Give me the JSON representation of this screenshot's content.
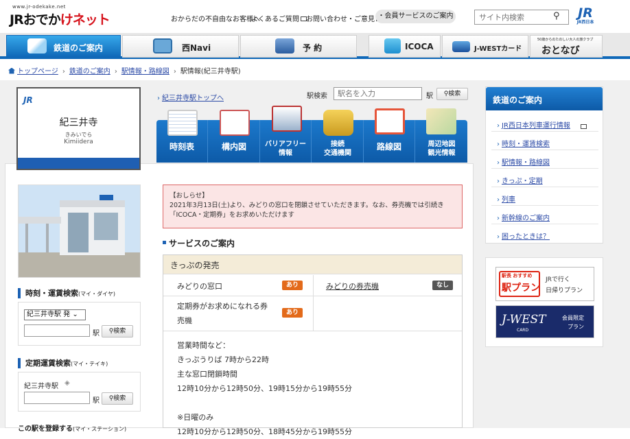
{
  "header": {
    "site_url": "www.jr-odekake.net",
    "logo_text_a": "JRおでか",
    "logo_text_b": "けネット",
    "util_links": [
      "おからだの不自由なお客様へ",
      "よくあるご質問",
      "お問い合わせ・ご意見"
    ],
    "member_button": "・会員サービスのご案内",
    "search_placeholder": "サイト内検索",
    "jr_logo_text": "JR",
    "jr_logo_sub": "JR西日本"
  },
  "global_nav": [
    {
      "label": "鉄道のご案内",
      "icon": "train-icon",
      "active": true
    },
    {
      "label": "西Navi",
      "icon": "camera-icon",
      "active": false
    },
    {
      "label": "予 約",
      "icon": "airplane-icon",
      "active": false
    },
    {
      "label": "ICOCA",
      "icon": "icoca-icon",
      "active": false
    },
    {
      "label": "J-WESTカード",
      "icon": "card-icon",
      "active": false
    },
    {
      "label": "おとなび",
      "icon": "otonavi-logo",
      "sublabel": "50歳からのたのしい大人の旅クラブ",
      "active": false
    }
  ],
  "breadcrumb": [
    "トップページ",
    "鉄道のご案内",
    "駅情報・路線図",
    "駅情報(紀三井寺駅)"
  ],
  "station": {
    "jr": "JR",
    "name": "紀三井寺",
    "kana": "きみいでら",
    "roman": "Kimiidera",
    "top_link": "紀三井寺駅トップへ"
  },
  "station_search": {
    "label": "駅検索",
    "placeholder": "駅名を入力",
    "suffix": "駅",
    "button": "検索"
  },
  "station_menu": [
    {
      "label": "時刻表",
      "icon": "timetable-icon"
    },
    {
      "label": "構内図",
      "icon": "floor-map-icon"
    },
    {
      "label": "バリアフリー\n情報",
      "icon": "barrier-free-icon"
    },
    {
      "label": "接続\n交通機関",
      "icon": "bus-icon"
    },
    {
      "label": "路線図",
      "icon": "route-map-icon"
    },
    {
      "label": "周辺地図\n観光情報",
      "icon": "map-icon"
    }
  ],
  "notice": {
    "title": "【おしらせ】",
    "line1": "2021年3月13日(土)より、みどりの窓口を閉鎖させていただきます。なお、券売機では引続き",
    "line2": "「ICOCA・定期券」をお求めいただけます"
  },
  "services": {
    "title": "サービスのご案内",
    "section": "きっぷの発売",
    "rows": [
      {
        "label": "みどりの窓口",
        "badge": "あり"
      },
      {
        "label": "みどりの券売機",
        "badge": "なし"
      },
      {
        "label_1": "定期券がお求めになれる券",
        "label_2": "売機",
        "badge": "あり"
      }
    ],
    "hours_text": "営業時間など：\nきっぷうりば 7時から22時\n主な窓口閉鎖時間\n12時10分から12時50分、19時15分から19時55分\n\n※日曜のみ\n12時10分から12時50分、18時45分から19時55分"
  },
  "left": {
    "timetable_title": "時刻・運賃検索",
    "timetable_sub": "(マイ・ダイヤ)",
    "timetable_select": "紀三井寺駅 発",
    "timetable_suffix": "駅",
    "timetable_button": "検索",
    "pass_title": "定期運賃検索",
    "pass_sub": "(マイ・テイキ)",
    "pass_station": "紀三井寺駅",
    "pass_suffix": "駅",
    "pass_button": "検索",
    "register_title": "この駅を登録する",
    "register_sub": "(マイ・ステーション)"
  },
  "sidebar": {
    "title": "鉄道のご案内",
    "items": [
      "JR西日本列車運行情報",
      "時刻・運賃検索",
      "駅情報・路線図",
      "きっぷ・定期",
      "列車",
      "新幹線のご案内",
      "困ったときは？"
    ]
  },
  "banners": {
    "b1_tag": "駅長 おすすめ",
    "b1_main": "駅プラン",
    "b1_side": "JRで行く",
    "b1_side2": "日帰りプラン",
    "b2_main": "J-WEST",
    "b2_card": "CARD",
    "b2_side": "会員限定",
    "b2_side2": "プラン"
  },
  "colors": {
    "brand_blue": "#0f68b8",
    "accent_orange": "#e36a1a",
    "notice_bg": "#fbe5e5"
  }
}
